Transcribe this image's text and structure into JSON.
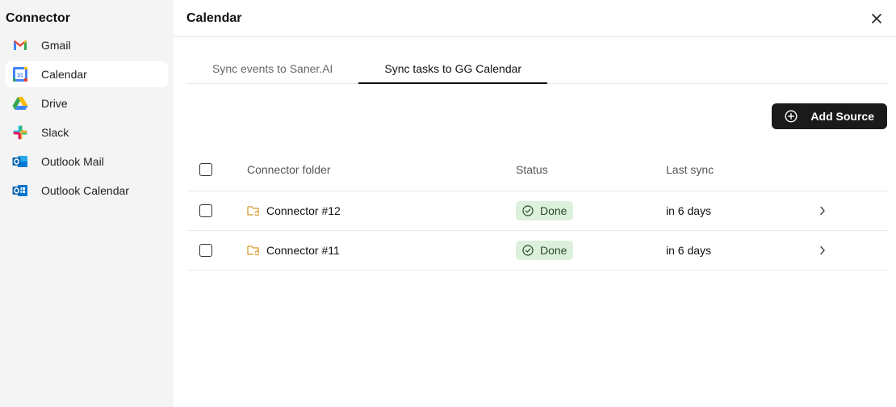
{
  "sidebar": {
    "title": "Connector",
    "items": [
      {
        "label": "Gmail",
        "icon": "gmail-icon",
        "active": false
      },
      {
        "label": "Calendar",
        "icon": "google-calendar-icon",
        "active": true
      },
      {
        "label": "Drive",
        "icon": "google-drive-icon",
        "active": false
      },
      {
        "label": "Slack",
        "icon": "slack-icon",
        "active": false
      },
      {
        "label": "Outlook Mail",
        "icon": "outlook-mail-icon",
        "active": false
      },
      {
        "label": "Outlook Calendar",
        "icon": "outlook-calendar-icon",
        "active": false
      }
    ]
  },
  "header": {
    "title": "Calendar"
  },
  "tabs": [
    {
      "label": "Sync events to Saner.AI",
      "active": false
    },
    {
      "label": "Sync tasks to GG Calendar",
      "active": true
    }
  ],
  "toolbar": {
    "add_source_label": "Add Source"
  },
  "table": {
    "columns": [
      "Connector folder",
      "Status",
      "Last sync"
    ],
    "rows": [
      {
        "folder": "Connector #12",
        "status": "Done",
        "last_sync": "in 6 days"
      },
      {
        "folder": "Connector #11",
        "status": "Done",
        "last_sync": "in 6 days"
      }
    ]
  },
  "colors": {
    "sidebar_bg": "#f4f4f5",
    "button_bg": "#1a1a1a",
    "badge_bg": "#dcf0dc",
    "folder_icon": "#d89a2b"
  },
  "calendar_icon_text": "31"
}
